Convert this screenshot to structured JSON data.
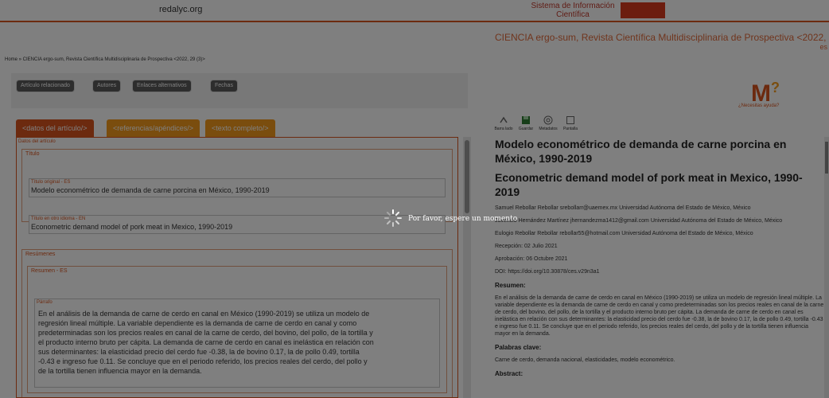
{
  "header": {
    "site_logo": "redalyc.org",
    "system_label": "Sistema de Información Científica",
    "journal_title": "CIENCIA ergo-sum, Revista Científica Multidisciplinaria de Prospectiva <2022, 29 (3)>",
    "lang": "es"
  },
  "breadcrumb": "Home » CIENCIA ergo-sum, Revista Científica Multidisciplinaria de Prospectiva <2022, 29 (3)>",
  "toolbar": {
    "buttons": [
      "Artículo relacionado",
      "Autores",
      "Enlaces alternativos",
      "Fechas"
    ]
  },
  "tabs": {
    "datos": "<datos del artículo/>",
    "referencias": "<referencias/apéndices/>",
    "texto": "<texto completo/>"
  },
  "left": {
    "panel_caption": "Datos del artículo",
    "titulo_group": "Título",
    "titulo_original_label": "Título original - ES",
    "titulo_original": "Modelo econométrico de demanda de carne porcina en México, 1990-2019",
    "titulo_otro_label": "Título en otro idioma - EN",
    "titulo_otro": "Econometric demand model of pork meat in Mexico, 1990-2019",
    "resumen_group": "Resúmenes",
    "resumen_label": "Resumen - ES",
    "parrafo_label": "Párrafo",
    "resumen_lines": [
      "En el análisis de la demanda de carne de cerdo en canal en México (1990-2019) se utiliza un modelo de",
      "regresión lineal múltiple. La variable dependiente es la demanda de carne de cerdo en canal y como",
      "predeterminadas son los precios reales en canal de la carne de cerdo, del bovino, del pollo, de la tortilla y",
      "el producto interno bruto per cápita. La demanda de carne de cerdo en canal es inelástica en relación con",
      "sus determinantes: la elasticidad precio del cerdo fue -0.38, la de bovino 0.17, la de pollo 0.49, tortilla",
      "-0.43 e ingreso fue 0.11. Se concluye que en el periodo referido, los precios reales del cerdo, del pollo y",
      "de la tortilla tienen influencia mayor en la demanda."
    ]
  },
  "right": {
    "help_label": "¿Necesitas ayuda?",
    "tools": [
      "Barra lado",
      "Guardar",
      "Metadatos",
      "Pantalla"
    ],
    "title_es": "Modelo econométrico de demanda de carne porcina en México, 1990-2019",
    "title_en": "Econometric demand model of pork meat in Mexico, 1990-2019",
    "author1": "Samuel Rebollar Rebollar srebollarr@uaemex.mx Universidad Autónoma del Estado de México, México",
    "author2": "Juvencio Hernández Martínez jhernandezma1412@gmail.com Universidad Autónoma del Estado de México, México",
    "author3": "Eulogio Rebollar Rebollar rebollar55@hotmail.com Universidad Autónoma del Estado de México, México",
    "received": "Recepción: 02 Julio 2021",
    "approved": "Aprobación: 06 Octubre 2021",
    "doi": "DOI: https://doi.org/10.30878/ces.v29n3a1",
    "resumen_heading": "Resumen:",
    "resumen": "En el análisis de la demanda de carne de cerdo en canal en México (1990-2019) se utiliza un modelo de regresión lineal múltiple. La variable dependiente es la demanda de carne de cerdo en canal y como predeterminadas son los precios reales en canal de la carne de cerdo, del bovino, del pollo, de la tortilla y el producto interno bruto per cápita. La demanda de carne de cerdo en canal es inelástica en relación con sus determinantes: la elasticidad precio del cerdo fue -0.38, la de bovino 0.17, la de pollo 0.49, tortilla -0.43 e ingreso fue 0.11. Se concluye que en el periodo referido, los precios reales del cerdo, del pollo y de la tortilla tienen influencia mayor en la demanda.",
    "keywords_heading": "Palabras clave:",
    "keywords": "Carne de cerdo, demanda nacional, elasticidades, modelo econométrico.",
    "abstract_heading": "Abstract:"
  },
  "overlay": {
    "message": "Por favor, espere un momento"
  },
  "colors": {
    "accent": "#d9541e",
    "tab_inactive": "#f59a1c",
    "overlay": "rgba(0,0,0,0.5)"
  }
}
